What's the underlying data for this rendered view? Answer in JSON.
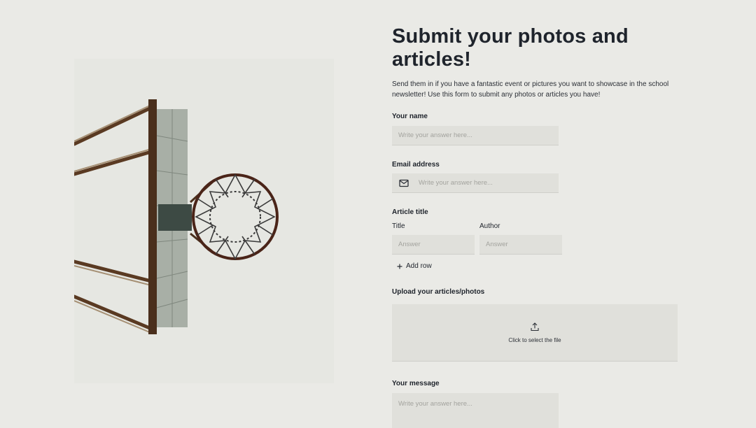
{
  "form": {
    "title": "Submit your photos and articles!",
    "description": "Send them in if you have a fantastic event or pictures you want to showcase in the school newsletter! Use this form to submit any photos or articles you have!",
    "name": {
      "label": "Your name",
      "placeholder": "Write your answer here..."
    },
    "email": {
      "label": "Email address",
      "placeholder": "Write your answer here...",
      "icon": "mail-icon"
    },
    "article": {
      "label": "Article title",
      "columns": [
        {
          "label": "Title",
          "placeholder": "Answer"
        },
        {
          "label": "Author",
          "placeholder": "Answer"
        }
      ],
      "add_row_label": "Add row",
      "add_row_icon": "plus-icon"
    },
    "upload": {
      "label": "Upload your articles/photos",
      "text": "Click to select the file",
      "icon": "upload-icon"
    },
    "message": {
      "label": "Your message",
      "placeholder": "Write your answer here..."
    }
  },
  "image": {
    "subject": "basketball-hoop-photo"
  }
}
